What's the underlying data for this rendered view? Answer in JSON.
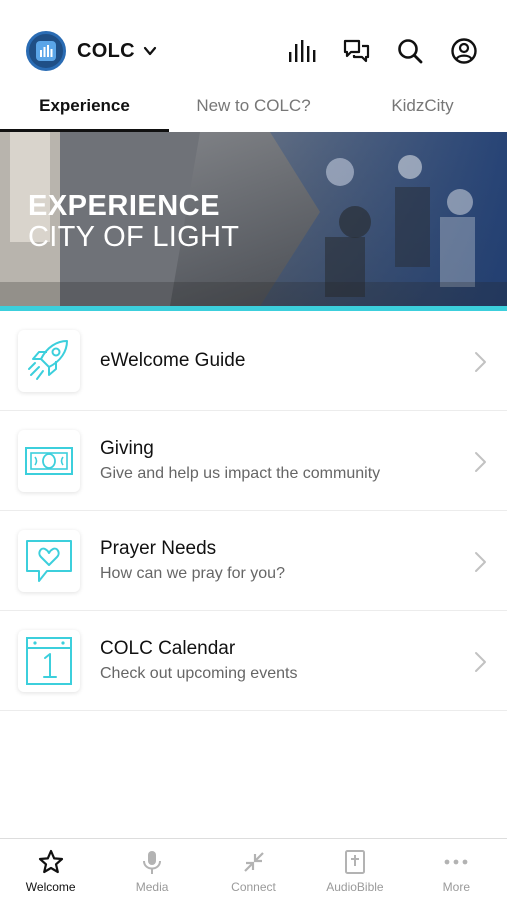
{
  "header": {
    "brand_name": "COLC",
    "brand_color": "#1f4f86",
    "icons": [
      "audio-bars-icon",
      "chat-icon",
      "search-icon",
      "profile-icon"
    ]
  },
  "tabs": [
    {
      "label": "Experience",
      "active": true
    },
    {
      "label": "New to COLC?",
      "active": false
    },
    {
      "label": "KidzCity",
      "active": false
    }
  ],
  "banner": {
    "title": "EXPERIENCE",
    "subtitle": "CITY OF LIGHT",
    "accent": "#3ccfdc"
  },
  "items": [
    {
      "title": "eWelcome Guide",
      "subtitle": "",
      "icon": "rocket-icon"
    },
    {
      "title": "Giving",
      "subtitle": "Give and help us impact the community",
      "icon": "money-icon"
    },
    {
      "title": "Prayer Needs",
      "subtitle": "How can we pray for you?",
      "icon": "heart-chat-icon"
    },
    {
      "title": "COLC Calendar",
      "subtitle": "Check out upcoming events",
      "icon": "calendar-icon"
    }
  ],
  "bottom_nav": [
    {
      "label": "Welcome",
      "icon": "star-icon",
      "active": true
    },
    {
      "label": "Media",
      "icon": "microphone-icon",
      "active": false
    },
    {
      "label": "Connect",
      "icon": "arrows-in-icon",
      "active": false
    },
    {
      "label": "AudioBible",
      "icon": "bible-icon",
      "active": false
    },
    {
      "label": "More",
      "icon": "more-icon",
      "active": false
    }
  ]
}
